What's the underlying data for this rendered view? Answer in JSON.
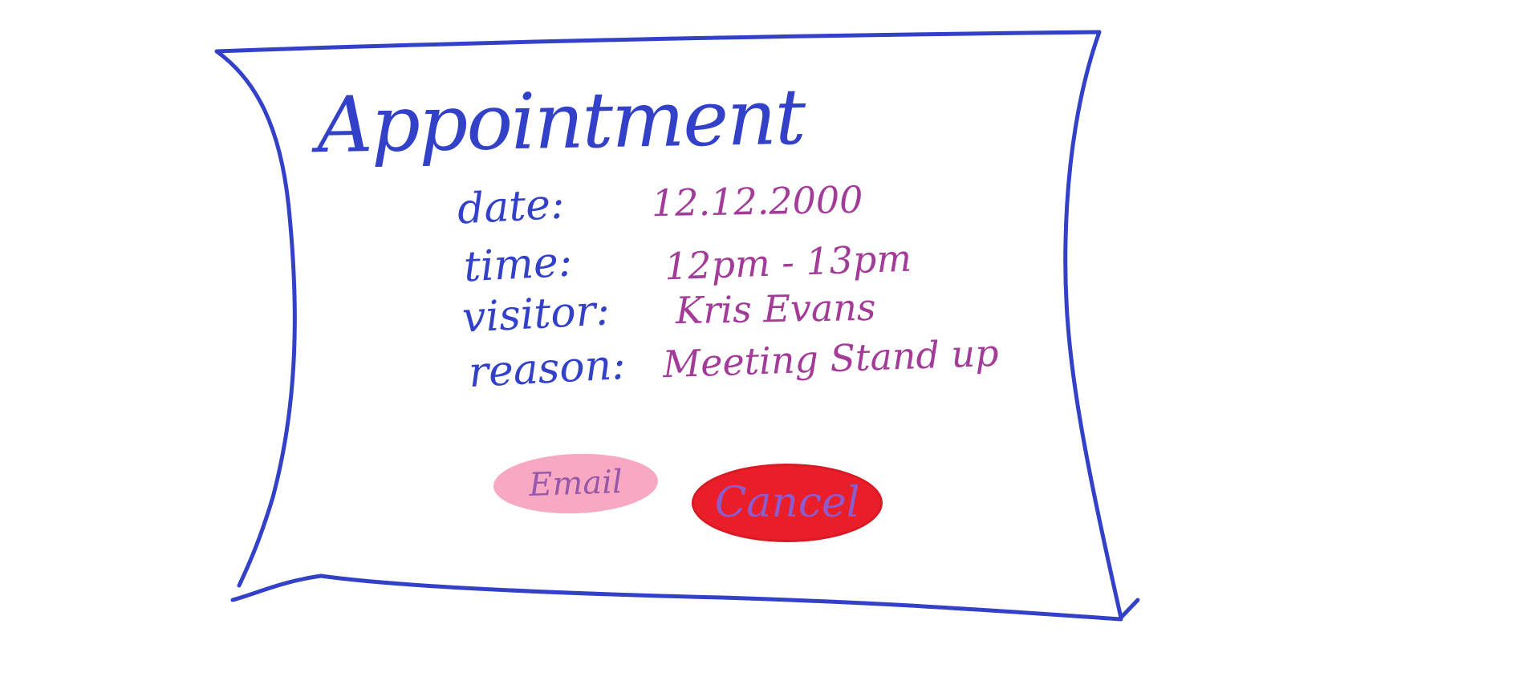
{
  "title": "Appointment",
  "fields": [
    {
      "label": "date:",
      "value": "12.12.2000"
    },
    {
      "label": "time:",
      "value": "12pm - 13pm"
    },
    {
      "label": "visitor:",
      "value": "Kris Evans"
    },
    {
      "label": "reason:",
      "value": "Meeting Stand up"
    }
  ],
  "buttons": {
    "email": "Email",
    "cancel": "Cancel"
  },
  "colors": {
    "ink_blue": "#3340c8",
    "ink_purple": "#a23c98",
    "email_fill": "#f7a8c3",
    "cancel_fill": "#ea1e28"
  }
}
